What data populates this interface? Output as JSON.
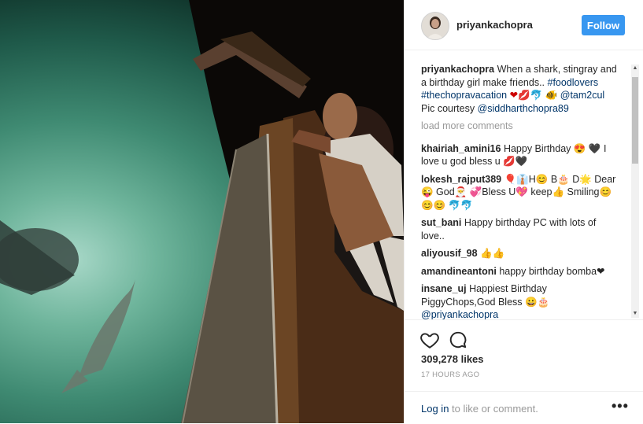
{
  "post": {
    "author": "priyankachopra",
    "follow_label": "Follow",
    "caption": {
      "text": "When a shark, stingray and a birthday girl make friends..",
      "hashtags": "#foodlovers #thechopravacation",
      "emojis": "❤💋🐬",
      "mention": "@tam2cul",
      "mention_prefix": "🐠",
      "credit_prefix": "Pic courtesy",
      "credit_mention": "@siddharthchopra89"
    },
    "load_more_label": "load more comments",
    "comments": [
      {
        "user": "khairiah_amini16",
        "text": "Happy Birthday 😍 🖤 I love u god bless u 💋🖤"
      },
      {
        "user": "lokesh_rajput389",
        "text": "🎈👔H😊 B🎂 D🌟 Dear😜 God🎅 💞Bless U💖 keep👍 Smiling😊😊😊 🐬🐬"
      },
      {
        "user": "sut_bani",
        "text": "Happy birthday PC with lots of love.."
      },
      {
        "user": "aliyousif_98",
        "text": "👍👍"
      },
      {
        "user": "amandineantoni",
        "text": "happy birthday bomba❤"
      },
      {
        "user": "insane_uj",
        "text": "Happiest Birthday PiggyChops,God Bless 😀🎂",
        "mention": "@priyankachopra"
      }
    ],
    "likes": "309,278 likes",
    "time": "17 HOURS AGO",
    "login_link": "Log in",
    "login_rest": " to like or comment.",
    "more_label": "•••"
  },
  "icons": {
    "like": "heart-icon",
    "comment": "comment-icon",
    "more": "more-options-icon"
  }
}
